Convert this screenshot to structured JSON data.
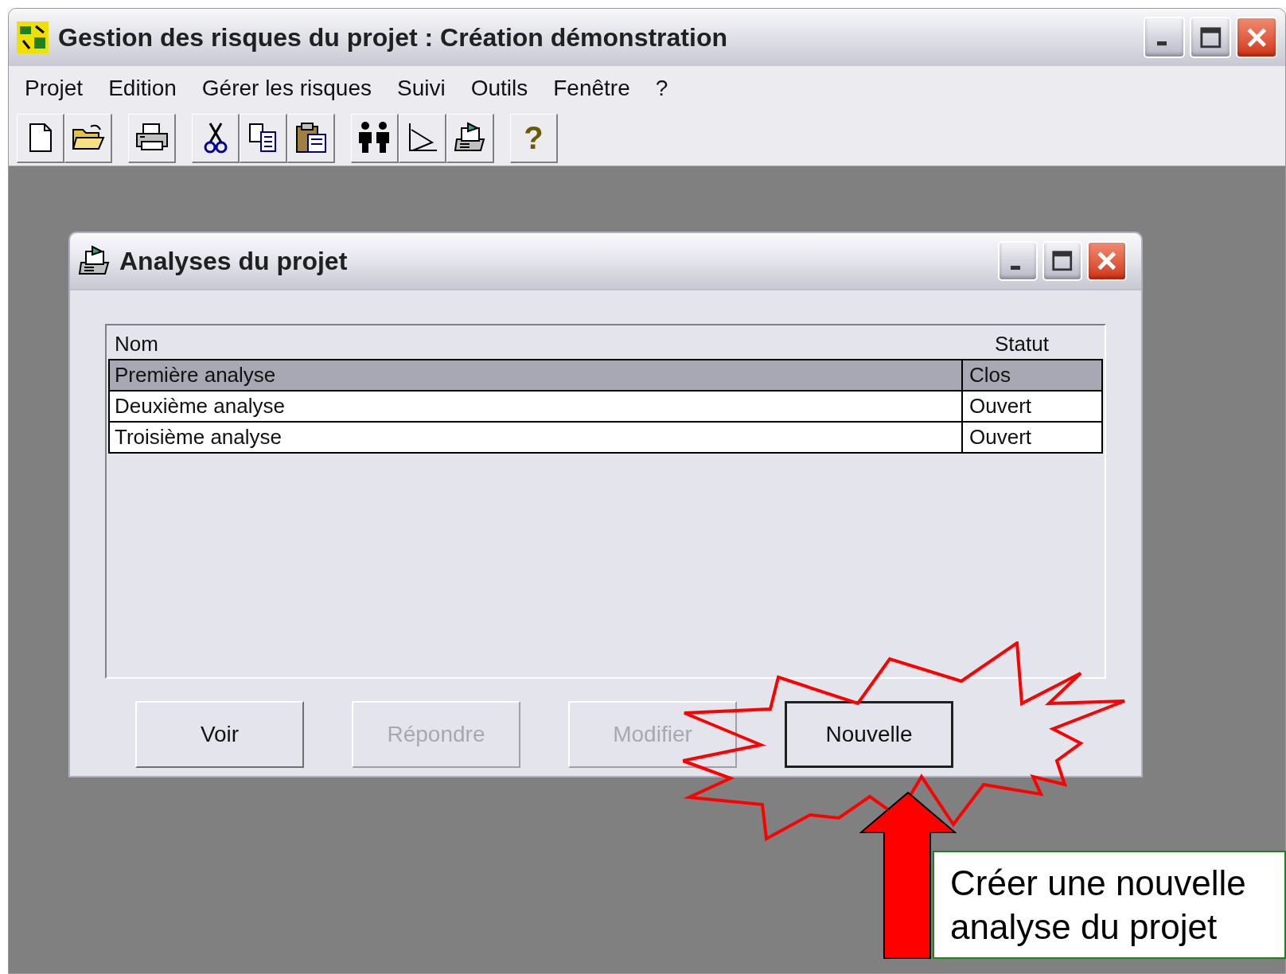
{
  "window": {
    "title": "Gestion des risques du projet : Création démonstration"
  },
  "menu": [
    "Projet",
    "Edition",
    "Gérer les risques",
    "Suivi",
    "Outils",
    "Fenêtre",
    "?"
  ],
  "toolbar": [
    [
      {
        "kind": "new"
      },
      {
        "kind": "open"
      }
    ],
    [
      {
        "kind": "print"
      }
    ],
    [
      {
        "kind": "cut"
      },
      {
        "kind": "copy"
      },
      {
        "kind": "paste"
      }
    ],
    [
      {
        "kind": "people"
      },
      {
        "kind": "chart"
      },
      {
        "kind": "analysis"
      }
    ],
    [
      {
        "kind": "help",
        "glyph": "?"
      }
    ]
  ],
  "child_window": {
    "title": "Analyses du projet"
  },
  "table": {
    "columns": [
      "Nom",
      "Statut"
    ],
    "rows": [
      {
        "cells": [
          "Première analyse",
          "Clos"
        ],
        "selected": true
      },
      {
        "cells": [
          "Deuxième analyse",
          "Ouvert"
        ],
        "selected": false
      },
      {
        "cells": [
          "Troisième analyse",
          "Ouvert"
        ],
        "selected": false
      }
    ]
  },
  "buttons": [
    {
      "label": "Voir",
      "disabled": false
    },
    {
      "label": "Répondre",
      "disabled": true
    },
    {
      "label": "Modifier",
      "disabled": true
    },
    {
      "label": "Nouvelle",
      "disabled": false
    }
  ],
  "callout": {
    "text": "Créer une nouvelle analyse du projet"
  }
}
